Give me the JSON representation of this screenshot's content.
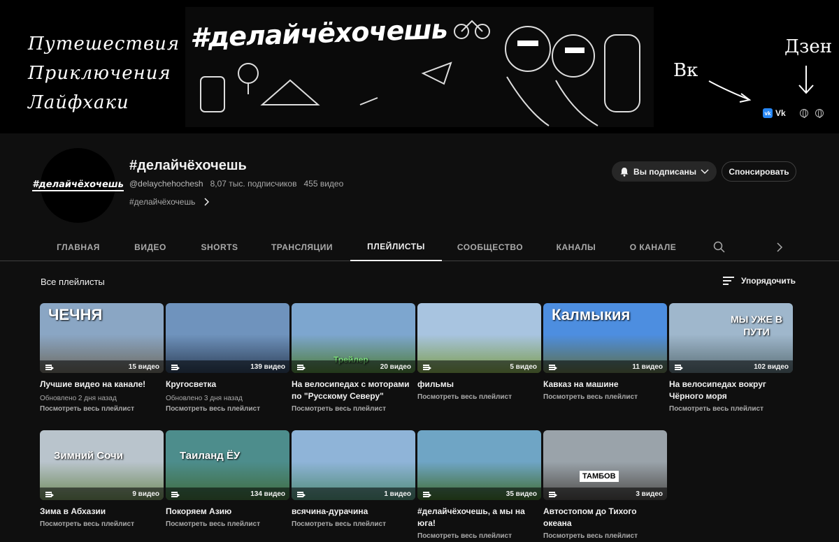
{
  "banner": {
    "left_lines": [
      "Путешествия",
      "Приключения",
      "Лайфхаки"
    ],
    "hashtag": "#делайчёхочешь",
    "vk_word": "Вк",
    "dzen_word": "Дзен",
    "links": {
      "vk_label": "Vk"
    }
  },
  "channel": {
    "avatar_text": "#делайчёхочешь",
    "title": "#делайчёхочешь",
    "handle": "@delaychehochesh",
    "subscribers": "8,07 тыс. подписчиков",
    "videos": "455 видео",
    "description": "#делайчёхочешь",
    "subscribed_label": "Вы подписаны",
    "sponsor_label": "Спонсировать"
  },
  "tabs": [
    "ГЛАВНАЯ",
    "ВИДЕО",
    "SHORTS",
    "ТРАНСЛЯЦИИ",
    "ПЛЕЙЛИСТЫ",
    "СООБЩЕСТВО",
    "КАНАЛЫ",
    "О КАНАЛЕ"
  ],
  "section": {
    "title": "Все плейлисты",
    "sort_label": "Упорядочить"
  },
  "playlists": [
    {
      "title": "Лучшие видео на канале!",
      "count": "15 видео",
      "updated": "Обновлено 2 дня назад",
      "link": "Посмотреть весь плейлист",
      "thumb_text": "ЧЕЧНЯ",
      "colors": [
        "#8aa6c4",
        "#6d6a60"
      ]
    },
    {
      "title": "Кругосветка",
      "count": "139 видео",
      "updated": "Обновлено 3 дня назад",
      "link": "Посмотреть весь плейлист",
      "thumb_text": "",
      "colors": [
        "#6f93bd",
        "#2e4058"
      ]
    },
    {
      "title": "На велосипедах с моторами по \"Русскому Северу\"",
      "count": "20 видео",
      "updated": "",
      "link": "Посмотреть весь плейлист",
      "thumb_text": "Трейлер",
      "colors": [
        "#7da6cf",
        "#4f7d3a"
      ]
    },
    {
      "title": "фильмы",
      "count": "5 видео",
      "updated": "",
      "link": "Посмотреть весь плейлист",
      "thumb_text": "",
      "colors": [
        "#a8c4e0",
        "#7c9d4c"
      ]
    },
    {
      "title": "Кавказ на машине",
      "count": "11 видео",
      "updated": "",
      "link": "Посмотреть весь плейлист",
      "thumb_text": "Калмыкия",
      "colors": [
        "#4d8ee0",
        "#5e6e48"
      ]
    },
    {
      "title": "На велосипедах вокруг Чёрного моря",
      "count": "102 видео",
      "updated": "",
      "link": "Посмотреть весь плейлист",
      "thumb_text": "МЫ УЖЕ В ПУТИ",
      "colors": [
        "#9fb7cc",
        "#5b6f76"
      ]
    },
    {
      "title": "Зима в Абхазии",
      "count": "9 видео",
      "updated": "",
      "link": "Посмотреть весь плейлист",
      "thumb_text": "Зимний Сочи",
      "colors": [
        "#b9c4cc",
        "#6f8a5a"
      ]
    },
    {
      "title": "Покоряем Азию",
      "count": "134 видео",
      "updated": "",
      "link": "Посмотреть весь плейлист",
      "thumb_text": "Таиланд ЁУ",
      "colors": [
        "#4d8d8c",
        "#3f6b3c"
      ]
    },
    {
      "title": "всячина-дурачина",
      "count": "1 видео",
      "updated": "",
      "link": "Посмотреть весь плейлист",
      "thumb_text": "",
      "colors": [
        "#8fb4d8",
        "#4f8a74"
      ]
    },
    {
      "title": "#делайчёхочешь, а мы на юга!",
      "count": "35 видео",
      "updated": "",
      "link": "Посмотреть весь плейлист",
      "thumb_text": "",
      "colors": [
        "#6fa5c5",
        "#3f6b2c"
      ]
    },
    {
      "title": "Автостопом до Тихого океана",
      "count": "3 видео",
      "updated": "",
      "link": "Посмотреть весь плейлист",
      "thumb_text": "ТАМБОВ",
      "colors": [
        "#9aa3aa",
        "#4d4a48"
      ]
    }
  ]
}
